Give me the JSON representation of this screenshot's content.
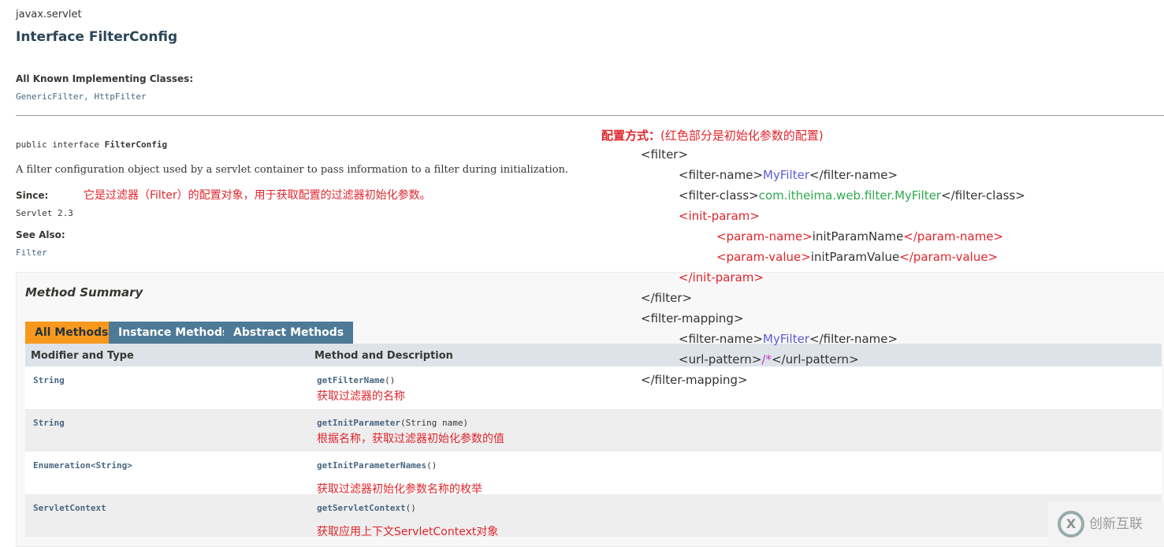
{
  "package": "javax.servlet",
  "title": "Interface FilterConfig",
  "implementing_label": "All Known Implementing Classes:",
  "implementing": [
    "GenericFilter",
    "HttpFilter"
  ],
  "signature_prefix": "public interface ",
  "signature_name": "FilterConfig",
  "description": "A filter configuration object used by a servlet container to pass information to a filter during initialization.",
  "annotation": "它是过滤器（Filter）的配置对象，用于获取配置的过滤器初始化参数。",
  "since_label": "Since:",
  "since_value": "Servlet 2.3",
  "see_also_label": "See Also:",
  "see_also_value": "Filter",
  "summary": {
    "title": "Method Summary",
    "tabs": [
      "All Methods",
      "Instance Methods",
      "Abstract Methods"
    ],
    "headers": [
      "Modifier and Type",
      "Method and Description"
    ],
    "rows": [
      {
        "type": "String",
        "method": "getFilterName",
        "params": "()",
        "note": "获取过滤器的名称"
      },
      {
        "type": "String",
        "method": "getInitParameter",
        "params": "(String  name)",
        "note": "根据名称，获取过滤器初始化参数的值"
      },
      {
        "type": "Enumeration<String>",
        "method": "getInitParameterNames",
        "params": "()",
        "note": "获取过滤器初始化参数名称的枚举"
      },
      {
        "type": "ServletContext",
        "method": "getServletContext",
        "params": "()",
        "note": "获取应用上下文ServletContext对象"
      }
    ]
  },
  "config": {
    "heading": "配置方式：",
    "heading_note": "(红色部分是初始化参数的配置)",
    "filter_open": "<filter>",
    "fn_open": "<filter-name>",
    "fn_value": "MyFilter",
    "fn_close": "</filter-name>",
    "fc_open": "<filter-class>",
    "fc_value": "com.itheima.web.filter.MyFilter",
    "fc_close": "</filter-class>",
    "ip_open": "<init-param>",
    "pn_open": "<param-name>",
    "pn_value": "initParamName",
    "pn_close": "</param-name>",
    "pv_open": "<param-value>",
    "pv_value": "initParamValue",
    "pv_close": "</param-value>",
    "ip_close": "</init-param>",
    "filter_close": "</filter>",
    "fm_open": "<filter-mapping>",
    "fn2_open": "<filter-name>",
    "fn2_value": "MyFilter",
    "fn2_close": "</filter-name>",
    "up_open": "<url-pattern>",
    "up_value": "/*",
    "up_close": "</url-pattern>",
    "fm_close": "</filter-mapping>"
  },
  "watermark": "创新互联",
  "colors": {
    "tab_active": "#f8981d",
    "tab": "#4d7a97",
    "annotation": "#e0262c"
  }
}
